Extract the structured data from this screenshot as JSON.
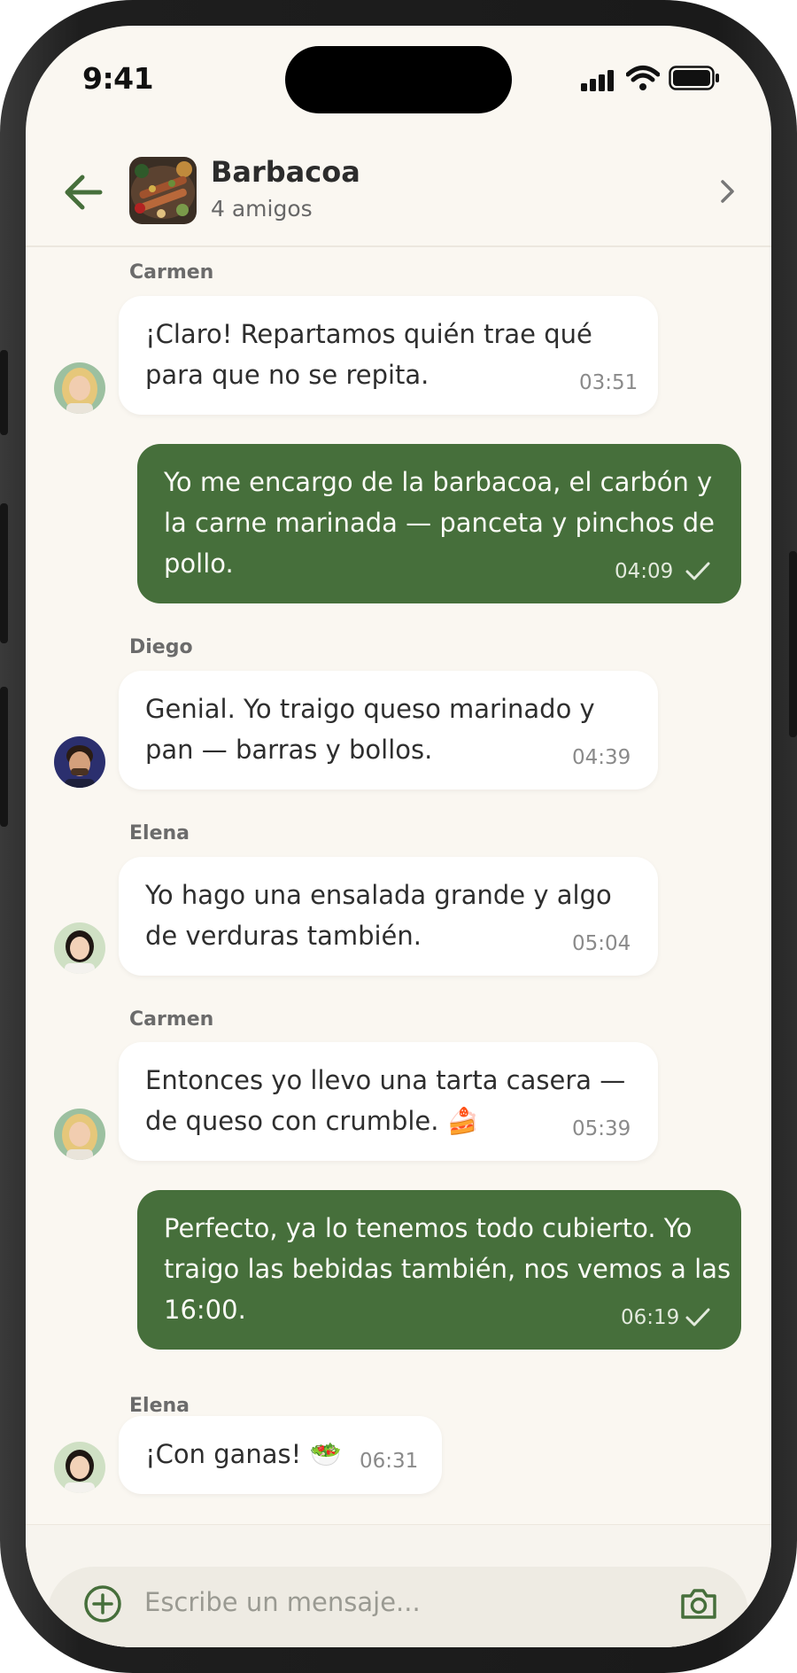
{
  "status_bar": {
    "time": "9:41"
  },
  "header": {
    "title": "Barbacoa",
    "subtitle": "4 amigos"
  },
  "messages": [
    {
      "sender": "Carmen",
      "line1": "¡Claro! Repartamos quién trae qué",
      "line2": "para que no se repita.",
      "time": "03:51",
      "incoming": true
    },
    {
      "sender": "",
      "line1": "Yo me encargo de la barbacoa, el carbón y",
      "line2": "la carne marinada — panceta y pinchos de",
      "line3": "pollo.",
      "time": "04:09",
      "incoming": false
    },
    {
      "sender": "Diego",
      "line1": "Genial. Yo traigo queso marinado y",
      "line2": "pan — barras y bollos.",
      "time": "04:39",
      "incoming": true
    },
    {
      "sender": "Elena",
      "line1": "Yo hago una ensalada grande y algo",
      "line2": "de verduras también.",
      "time": "05:04",
      "incoming": true
    },
    {
      "sender": "Carmen",
      "line1": "Entonces yo llevo una tarta casera —",
      "line2": "de queso con crumble. 🍰",
      "time": "05:39",
      "incoming": true
    },
    {
      "sender": "",
      "line1": "Perfecto, ya lo tenemos todo cubierto. Yo",
      "line2": "traigo las bebidas también, nos vemos a las",
      "line3": "16:00.",
      "time": "06:19",
      "incoming": false
    },
    {
      "sender": "Elena",
      "line1": "¡Con ganas! 🥗",
      "time": "06:31",
      "incoming": true
    }
  ],
  "composer": {
    "placeholder": "Escribe un mensaje..."
  },
  "colors": {
    "accent": "#466f3b",
    "background": "#faf7f1",
    "bubble_in": "#ffffff"
  },
  "icons": [
    "back-arrow-icon",
    "chevron-right-icon",
    "signal-icon",
    "wifi-icon",
    "battery-icon",
    "plus-circle-icon",
    "camera-icon",
    "read-check-icon"
  ]
}
